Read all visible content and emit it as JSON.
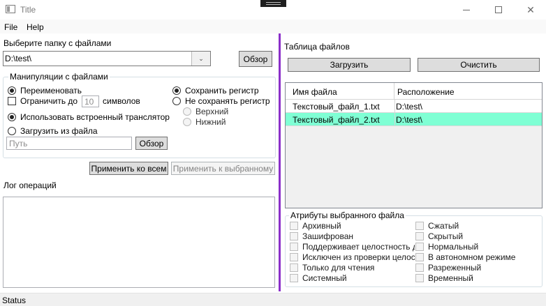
{
  "window": {
    "title": "Title"
  },
  "menu": {
    "file": "File",
    "help": "Help"
  },
  "left": {
    "folder_label": "Выберите папку с файлами",
    "folder_value": "D:\\test\\",
    "browse_label": "Обзор",
    "manip_group_title": "Манипуляции с файлами",
    "rename_label": "Переименовать",
    "limit_label": "Ограничить до",
    "limit_value": "10",
    "symbols_label": "символов",
    "builtin_translit_label": "Использовать встроенный транслятор",
    "load_from_file_label": "Загрузить из файла",
    "path_placeholder": "Путь",
    "path_browse_label": "Обзор",
    "keep_case_label": "Сохранить регистр",
    "no_keep_case_label": "Не сохранять регистр",
    "upper_label": "Верхний",
    "lower_label": "Нижний",
    "apply_all_label": "Применить ко всем",
    "apply_selected_label": "Применить к выбранному",
    "log_label": "Лог операций",
    "log_value": ""
  },
  "right": {
    "table_label": "Таблица файлов",
    "load_label": "Загрузить",
    "clear_label": "Очистить",
    "columns": [
      "Имя файла",
      "Расположение"
    ],
    "rows": [
      {
        "name": "Текстовый_файл_1.txt",
        "location": "D:\\test\\",
        "selected": false
      },
      {
        "name": "Текстовый_файл_2.txt",
        "location": "D:\\test\\",
        "selected": true
      }
    ],
    "attributes_title": "Атрибуты выбранного файла",
    "attributes_left": [
      "Архивный",
      "Зашифрован",
      "Поддерживает целостность данных",
      "Исключен из проверки целостности",
      "Только для чтения",
      "Системный"
    ],
    "attributes_right": [
      "Сжатый",
      "Скрытый",
      "Нормальный",
      "В автономном режиме",
      "Разреженный",
      "Временный"
    ]
  },
  "status": {
    "text": "Status"
  },
  "colors": {
    "splitter": "#8b2fc9",
    "selected_row": "#7fffd4"
  }
}
